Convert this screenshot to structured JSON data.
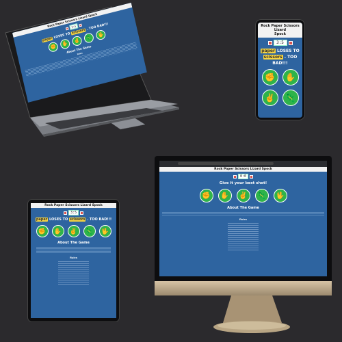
{
  "site": {
    "title": "Rock Paper Scissors Lizard Spock",
    "title_line1": "Rock Paper Scissors Lizard",
    "title_line2": "Spock",
    "score_text": "3:5",
    "desktop_score_text": "0:0",
    "result": {
      "player_choice": "paper",
      "loses_to": "LOSES TO",
      "computer_choice": "scissors",
      "too_bad": ". TOO BAD!!!"
    },
    "prompt": "Give it your best shot!",
    "about_heading": "About The Game",
    "rules_heading": "Rules",
    "choices": [
      {
        "name": "rock",
        "glyph": "✊"
      },
      {
        "name": "paper",
        "glyph": "✋"
      },
      {
        "name": "scissors",
        "glyph": "✌"
      },
      {
        "name": "lizard",
        "glyph": "🦎"
      },
      {
        "name": "spock",
        "glyph": "🖖"
      }
    ]
  },
  "colors": {
    "background": "#2b2a2d",
    "site_blue": "#2e64a0",
    "choice_green": "#2fb34a",
    "score_red": "#d9534f",
    "highlight_yellow": "#f5d442"
  }
}
